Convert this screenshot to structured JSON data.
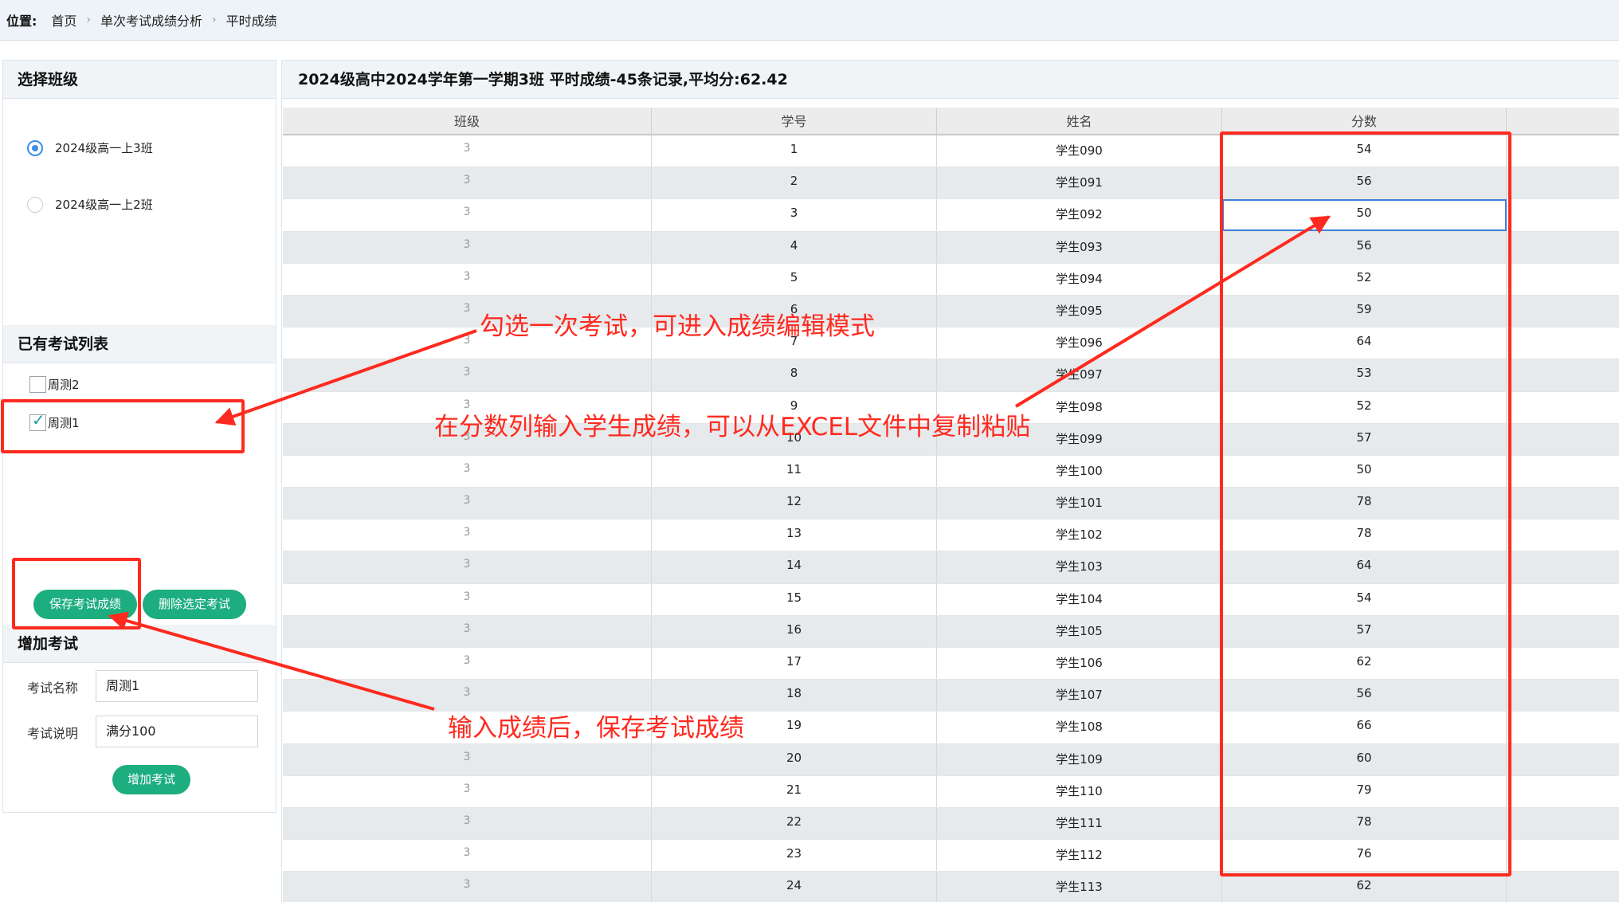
{
  "breadcrumb": {
    "label": "位置:",
    "items": [
      "首页",
      "单次考试成绩分析",
      "平时成绩"
    ]
  },
  "class_section": {
    "title": "选择班级",
    "options": [
      {
        "label": "2024级高一上3班",
        "selected": true
      },
      {
        "label": "2024级高一上2班",
        "selected": false
      }
    ]
  },
  "exam_list": {
    "title": "已有考试列表",
    "items": [
      {
        "label": "周测2",
        "checked": false
      },
      {
        "label": "周测1",
        "checked": true
      }
    ],
    "save_label": "保存考试成绩",
    "delete_label": "删除选定考试"
  },
  "add_exam": {
    "title": "增加考试",
    "name_label": "考试名称",
    "name_value": "周测1",
    "desc_label": "考试说明",
    "desc_value": "满分100",
    "button_label": "增加考试"
  },
  "grid": {
    "title": "2024级高中2024学年第一学期3班 平时成绩-45条记录,平均分:62.42",
    "columns": [
      "班级",
      "学号",
      "姓名",
      "分数"
    ],
    "rows": [
      [
        "3",
        "1",
        "学生090",
        "54"
      ],
      [
        "3",
        "2",
        "学生091",
        "56"
      ],
      [
        "3",
        "3",
        "学生092",
        "50"
      ],
      [
        "3",
        "4",
        "学生093",
        "56"
      ],
      [
        "3",
        "5",
        "学生094",
        "52"
      ],
      [
        "3",
        "6",
        "学生095",
        "59"
      ],
      [
        "3",
        "7",
        "学生096",
        "64"
      ],
      [
        "3",
        "8",
        "学生097",
        "53"
      ],
      [
        "3",
        "9",
        "学生098",
        "52"
      ],
      [
        "3",
        "10",
        "学生099",
        "57"
      ],
      [
        "3",
        "11",
        "学生100",
        "50"
      ],
      [
        "3",
        "12",
        "学生101",
        "78"
      ],
      [
        "3",
        "13",
        "学生102",
        "78"
      ],
      [
        "3",
        "14",
        "学生103",
        "64"
      ],
      [
        "3",
        "15",
        "学生104",
        "54"
      ],
      [
        "3",
        "16",
        "学生105",
        "57"
      ],
      [
        "3",
        "17",
        "学生106",
        "62"
      ],
      [
        "3",
        "18",
        "学生107",
        "56"
      ],
      [
        "3",
        "19",
        "学生108",
        "66"
      ],
      [
        "3",
        "20",
        "学生109",
        "60"
      ],
      [
        "3",
        "21",
        "学生110",
        "79"
      ],
      [
        "3",
        "22",
        "学生111",
        "78"
      ],
      [
        "3",
        "23",
        "学生112",
        "76"
      ],
      [
        "3",
        "24",
        "学生113",
        "62"
      ]
    ],
    "selected_row": 2
  },
  "annotations": {
    "note_select": "勾选一次考试，可进入成绩编辑模式",
    "note_input": "在分数列输入学生成绩，可以从EXCEL文件中复制粘贴",
    "note_save": "输入成绩后，保存考试成绩",
    "color": "#ff2a1f"
  },
  "colors": {
    "accent_green": "#1dae80",
    "radio_blue": "#3b8de8",
    "header_bg": "#edf3f8"
  }
}
